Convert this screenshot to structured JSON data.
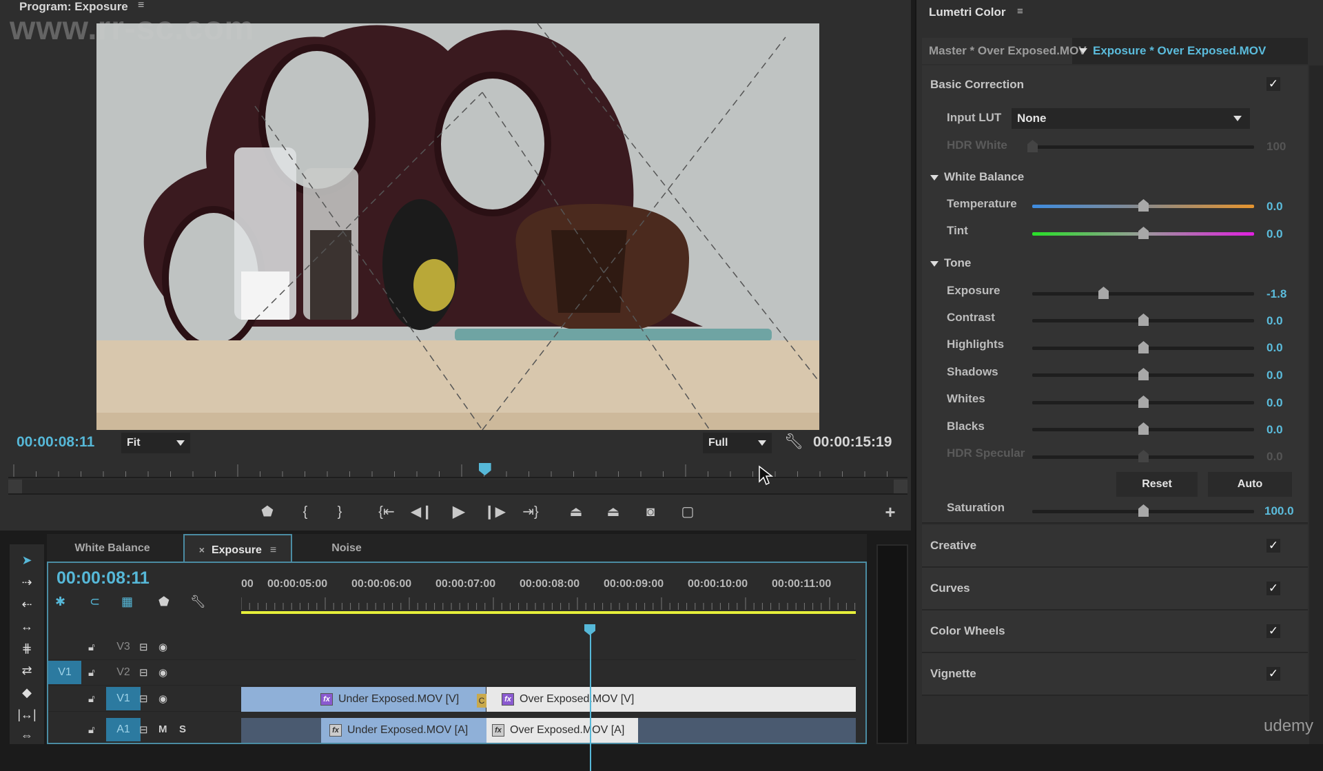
{
  "program_monitor": {
    "title": "Program: Exposure",
    "menu_icon": "hamburger-icon",
    "watermark": "www.rr-sc.com",
    "current_timecode": "00:00:08:11",
    "zoom_select": "Fit",
    "resolution_select": "Full",
    "duration_timecode": "00:00:15:19",
    "playhead_fraction": 0.53,
    "transport": [
      {
        "name": "add-marker",
        "glyph": "⬟"
      },
      {
        "name": "mark-in",
        "glyph": "{"
      },
      {
        "name": "mark-out",
        "glyph": "}"
      },
      {
        "name": "go-to-in",
        "glyph": "{⇤"
      },
      {
        "name": "step-back",
        "glyph": "◀|"
      },
      {
        "name": "play",
        "glyph": "▶"
      },
      {
        "name": "step-forward",
        "glyph": "|▶"
      },
      {
        "name": "go-to-out",
        "glyph": "⇥}"
      },
      {
        "name": "lift",
        "glyph": "⏏"
      },
      {
        "name": "extract",
        "glyph": "⏏"
      },
      {
        "name": "export-frame",
        "glyph": "📷"
      },
      {
        "name": "safe-margins",
        "glyph": "▢"
      }
    ],
    "add_button": "+"
  },
  "timeline": {
    "tabs": [
      {
        "label": "White Balance",
        "active": false
      },
      {
        "label": "Exposure",
        "active": true,
        "close": "×",
        "menu": "≡"
      },
      {
        "label": "Noise",
        "active": false
      }
    ],
    "current_timecode": "00:00:08:11",
    "ruler_labels": [
      "00",
      "00:00:05:00",
      "00:00:06:00",
      "00:00:07:00",
      "00:00:08:00",
      "00:00:09:00",
      "00:00:10:00",
      "00:00:11:00"
    ],
    "tracks": [
      {
        "name": "V3",
        "selected": false,
        "source": "",
        "icons": [
          "lock",
          "sync",
          "eye"
        ]
      },
      {
        "name": "V2",
        "selected": false,
        "source": "V1",
        "icons": [
          "lock",
          "sync",
          "eye"
        ]
      },
      {
        "name": "V1",
        "selected": true,
        "source": "",
        "icons": [
          "lock",
          "sync",
          "eye"
        ]
      },
      {
        "name": "A1",
        "selected": true,
        "source": "",
        "icons": [
          "lock",
          "sync",
          "M",
          "S"
        ]
      }
    ],
    "clips": {
      "v1_a": "Under Exposed.MOV [V]",
      "v1_b": "Over Exposed.MOV [V]",
      "a1_a": "Under Exposed.MOV [A]",
      "a1_b": "Over Exposed.MOV [A]",
      "fx": "fx",
      "transition": "C"
    }
  },
  "tools": [
    "selection",
    "track-select-forward",
    "track-select-backward",
    "ripple-edit",
    "rolling-edit",
    "rate-stretch",
    "razor",
    "slip",
    "slide"
  ],
  "lumetri": {
    "title": "Lumetri Color",
    "master_tab": "Master * Over Exposed.MOV",
    "active_tab": "Exposure * Over Exposed.MOV",
    "basic_correction": {
      "title": "Basic Correction",
      "enabled": true,
      "input_lut_label": "Input LUT",
      "input_lut_value": "None",
      "hdr_white_label": "HDR White",
      "hdr_white_value": "100",
      "white_balance_title": "White Balance",
      "temperature_label": "Temperature",
      "temperature_value": "0.0",
      "tint_label": "Tint",
      "tint_value": "0.0",
      "tone_title": "Tone",
      "tone": [
        {
          "label": "Exposure",
          "value": "-1.8",
          "fraction": 0.32,
          "dim": false
        },
        {
          "label": "Contrast",
          "value": "0.0",
          "fraction": 0.5,
          "dim": false
        },
        {
          "label": "Highlights",
          "value": "0.0",
          "fraction": 0.5,
          "dim": false
        },
        {
          "label": "Shadows",
          "value": "0.0",
          "fraction": 0.5,
          "dim": false
        },
        {
          "label": "Whites",
          "value": "0.0",
          "fraction": 0.5,
          "dim": false
        },
        {
          "label": "Blacks",
          "value": "0.0",
          "fraction": 0.5,
          "dim": false
        },
        {
          "label": "HDR Specular",
          "value": "0.0",
          "fraction": 0.5,
          "dim": true
        }
      ],
      "reset_label": "Reset",
      "auto_label": "Auto",
      "saturation_label": "Saturation",
      "saturation_value": "100.0"
    },
    "sections": [
      {
        "title": "Creative",
        "enabled": true
      },
      {
        "title": "Curves",
        "enabled": true
      },
      {
        "title": "Color Wheels",
        "enabled": true
      },
      {
        "title": "Vignette",
        "enabled": true
      }
    ],
    "check_glyph": "✓"
  },
  "colors": {
    "accent": "#56b8d8",
    "timeline_work_area": "#e6ef3a",
    "clip_selected": "#8fb0d8",
    "clip_unselected": "#e8e8e8"
  },
  "branding": "udemy"
}
